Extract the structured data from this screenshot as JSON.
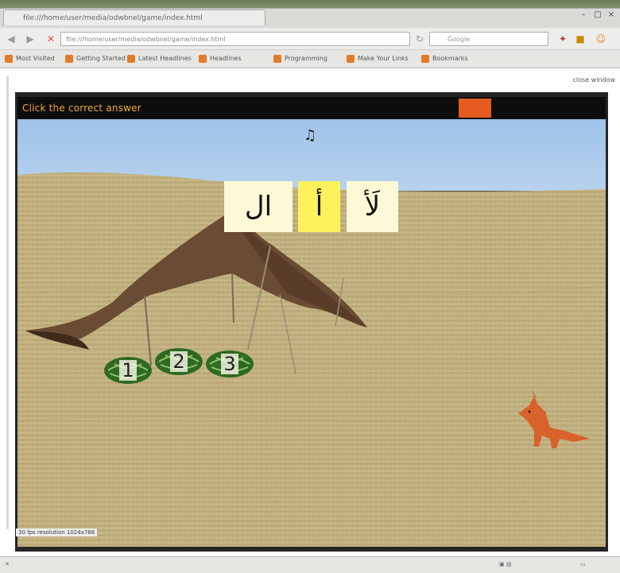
{
  "browser": {
    "tab_title": "file:///home/user/media/odwbnel/game/index.html",
    "url": "file:///home/user/media/odwbnel/game/index.html",
    "search_placeholder": "Google",
    "bookmarks": [
      "Most Visited",
      "Getting Started",
      "Latest Headlines",
      "Headlines",
      "Programming",
      "Make Your Links",
      "Bookmarks"
    ],
    "top_right_link": "close window"
  },
  "game": {
    "instruction": "Click the correct answer",
    "note_symbol": "♫",
    "answers": [
      {
        "text": "ال",
        "highlighted": false
      },
      {
        "text": "أ",
        "highlighted": true
      },
      {
        "text": "لَأ",
        "highlighted": false
      }
    ],
    "melons": [
      "1",
      "2",
      "3"
    ],
    "status": "30 fps resolution 1024x768"
  },
  "colors": {
    "instruction": "#f0a838",
    "orange_button": "#e55a1f",
    "card_normal": "#fdf9d6",
    "card_highlighted": "#fdf25c",
    "sky": "#a9c9ea",
    "sand": "#c2b07f"
  }
}
